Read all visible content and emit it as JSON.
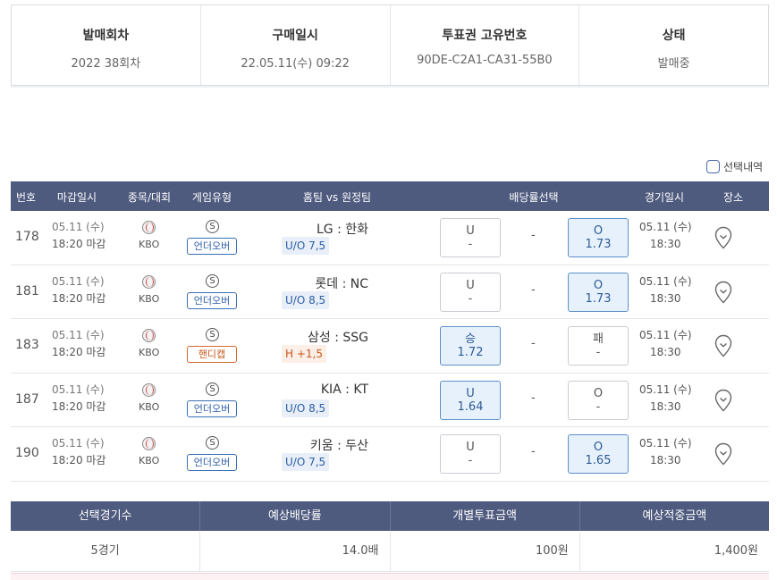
{
  "ticket_info": {
    "round_title": "발매회차",
    "round_value": "2022 38회차",
    "purchase_title": "구매일시",
    "purchase_value": "22.05.11(수) 09:22",
    "id_title": "투표권 고유번호",
    "id_value": "90DE-C2A1-CA31-55B0",
    "status_title": "상태",
    "status_value": "발매중"
  },
  "selection_toggle_label": "선택내역",
  "table": {
    "headers": {
      "no": "번호",
      "deadline": "마감일시",
      "sport": "종목/대회",
      "game_type": "게임유형",
      "teams": "홈팀 vs 원정팀",
      "odds": "배당률선택",
      "game_time": "경기일시",
      "venue": "장소"
    },
    "rows": [
      {
        "no": "178",
        "deadline_date": "05.11 (수)",
        "deadline_time": "18:20 마감",
        "league": "KBO",
        "type_icon": "S",
        "type_label": "언더오버",
        "type_color": "blue",
        "teams": "LG : 한화",
        "handicap": "U/O 7,5",
        "handicap_color": "blue",
        "left_label": "U",
        "left_value": "-",
        "left_selected": false,
        "mid": "-",
        "right_label": "O",
        "right_value": "1.73",
        "right_selected": true,
        "game_date": "05.11 (수)",
        "game_time": "18:30"
      },
      {
        "no": "181",
        "deadline_date": "05.11 (수)",
        "deadline_time": "18:20 마감",
        "league": "KBO",
        "type_icon": "S",
        "type_label": "언더오버",
        "type_color": "blue",
        "teams": "롯데 : NC",
        "handicap": "U/O 8,5",
        "handicap_color": "blue",
        "left_label": "U",
        "left_value": "-",
        "left_selected": false,
        "mid": "-",
        "right_label": "O",
        "right_value": "1.73",
        "right_selected": true,
        "game_date": "05.11 (수)",
        "game_time": "18:30"
      },
      {
        "no": "183",
        "deadline_date": "05.11 (수)",
        "deadline_time": "18:20 마감",
        "league": "KBO",
        "type_icon": "S",
        "type_label": "핸디캡",
        "type_color": "orange",
        "teams": "삼성 : SSG",
        "handicap": "H +1,5",
        "handicap_color": "orange",
        "left_label": "승",
        "left_value": "1.72",
        "left_selected": true,
        "mid": "-",
        "right_label": "패",
        "right_value": "-",
        "right_selected": false,
        "game_date": "05.11 (수)",
        "game_time": "18:30"
      },
      {
        "no": "187",
        "deadline_date": "05.11 (수)",
        "deadline_time": "18:20 마감",
        "league": "KBO",
        "type_icon": "S",
        "type_label": "언더오버",
        "type_color": "blue",
        "teams": "KIA : KT",
        "handicap": "U/O 8,5",
        "handicap_color": "blue",
        "left_label": "U",
        "left_value": "1.64",
        "left_selected": true,
        "mid": "-",
        "right_label": "O",
        "right_value": "-",
        "right_selected": false,
        "game_date": "05.11 (수)",
        "game_time": "18:30"
      },
      {
        "no": "190",
        "deadline_date": "05.11 (수)",
        "deadline_time": "18:20 마감",
        "league": "KBO",
        "type_icon": "S",
        "type_label": "언더오버",
        "type_color": "blue",
        "teams": "키움 : 두산",
        "handicap": "U/O 7,5",
        "handicap_color": "blue",
        "left_label": "U",
        "left_value": "-",
        "left_selected": false,
        "mid": "-",
        "right_label": "O",
        "right_value": "1.65",
        "right_selected": true,
        "game_date": "05.11 (수)",
        "game_time": "18:30"
      }
    ]
  },
  "summary": {
    "headers": [
      "선택경기수",
      "예상배당률",
      "개별투표금액",
      "예상적중금액"
    ],
    "values": [
      "5경기",
      "14.0배",
      "100원",
      "1,400원"
    ]
  },
  "colors": {
    "header_bg": "#4e5a7e",
    "selected_bg": "#e7f1fb",
    "blue_tag": "#2b5ea8",
    "orange_tag": "#c8571a"
  },
  "icons": {
    "sport": "baseball-icon",
    "venue": "location-pin-icon"
  }
}
